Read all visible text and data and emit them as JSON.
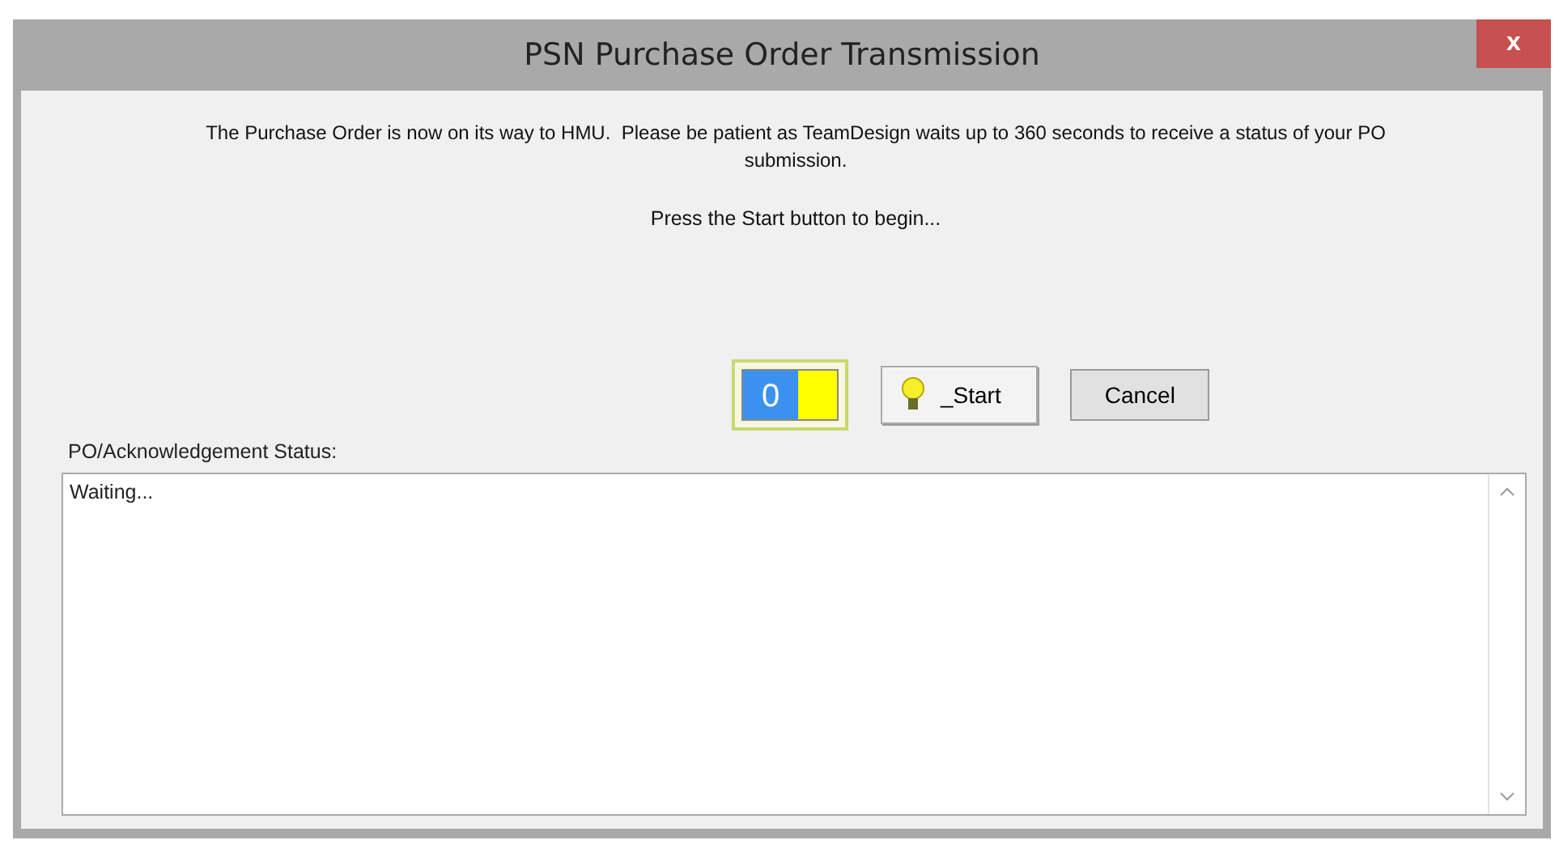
{
  "window": {
    "title": "PSN Purchase Order Transmission",
    "close": "x"
  },
  "message": "The Purchase Order is now on its way to HMU.  Please be patient as TeamDesign waits up to 360 seconds to receive a status of your PO submission.",
  "prompt": "Press the Start button to begin...",
  "counter": {
    "value": "0"
  },
  "buttons": [
    {
      "label": "_Start",
      "kind": "icon"
    },
    {
      "label": "Cancel",
      "kind": "plain"
    }
  ],
  "status": {
    "label": "PO/Acknowledgement Status:",
    "value": "Waiting..."
  }
}
